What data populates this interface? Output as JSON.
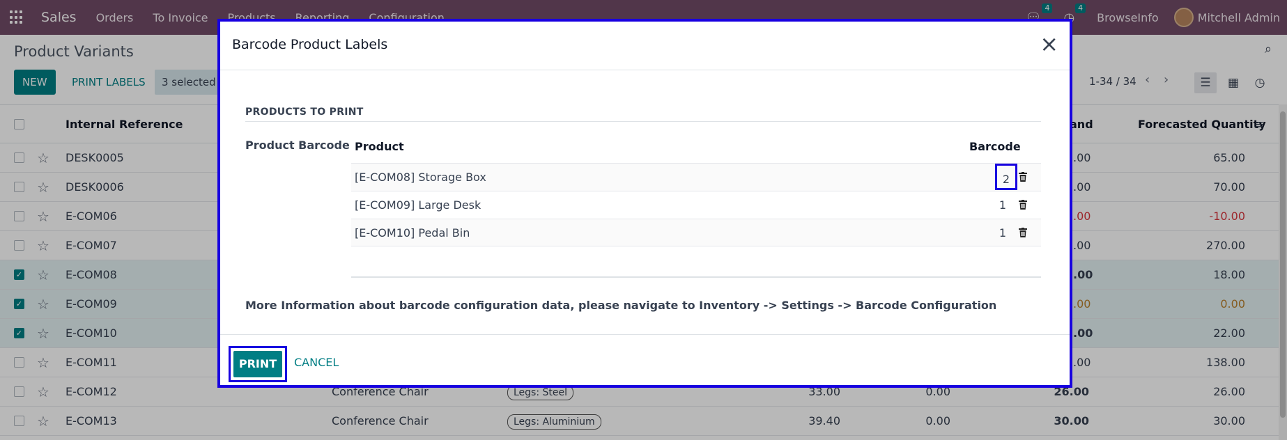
{
  "navbar": {
    "brand": "Sales",
    "menus": [
      "Orders",
      "To Invoice",
      "Products",
      "Reporting",
      "Configuration"
    ],
    "chat_count": "4",
    "activity_count": "4",
    "company": "BrowseInfo",
    "user": "Mitchell Admin"
  },
  "control": {
    "title": "Product Variants",
    "new_label": "NEW",
    "print_labels_label": "PRINT LABELS",
    "selected": "3 selected",
    "pager": "1-34 / 34"
  },
  "list": {
    "headers": {
      "internal_reference": "Internal Reference",
      "on_hand": "and",
      "forecasted": "Forecasted Quantity"
    },
    "rows": [
      {
        "ref": "DESK0005",
        "name": "",
        "attr": "",
        "price": "",
        "cost": "",
        "onhand": ".00",
        "forecast": "65.00",
        "selected": false
      },
      {
        "ref": "DESK0006",
        "name": "",
        "attr": "",
        "price": "",
        "cost": "",
        "onhand": ".00",
        "forecast": "70.00",
        "selected": false
      },
      {
        "ref": "E-COM06",
        "name": "",
        "attr": "",
        "price": "",
        "cost": "",
        "onhand": ".00",
        "forecast": "-10.00",
        "selected": false
      },
      {
        "ref": "E-COM07",
        "name": "",
        "attr": "",
        "price": "",
        "cost": "",
        "onhand": ".00",
        "forecast": "270.00",
        "selected": false
      },
      {
        "ref": "E-COM08",
        "name": "",
        "attr": "",
        "price": "",
        "cost": "",
        "onhand": ".00",
        "forecast": "18.00",
        "selected": true
      },
      {
        "ref": "E-COM09",
        "name": "",
        "attr": "",
        "price": "",
        "cost": "",
        "onhand": ".00",
        "forecast": "0.00",
        "selected": true
      },
      {
        "ref": "E-COM10",
        "name": "",
        "attr": "",
        "price": "",
        "cost": "",
        "onhand": ".00",
        "forecast": "22.00",
        "selected": true
      },
      {
        "ref": "E-COM11",
        "name": "",
        "attr": "",
        "price": "",
        "cost": "",
        "onhand": ".00",
        "forecast": "138.00",
        "selected": false
      },
      {
        "ref": "E-COM12",
        "name": "Conference Chair",
        "attr": "Legs: Steel",
        "price": "33.00",
        "cost": "0.00",
        "onhand": "26.00",
        "forecast": "26.00",
        "selected": false
      },
      {
        "ref": "E-COM13",
        "name": "Conference Chair",
        "attr": "Legs: Aluminium",
        "price": "39.40",
        "cost": "0.00",
        "onhand": "30.00",
        "forecast": "30.00",
        "selected": false
      }
    ]
  },
  "dialog": {
    "title": "Barcode Product Labels",
    "section": "PRODUCTS TO PRINT",
    "field_label": "Product Barcode",
    "col_product": "Product",
    "col_barcode": "Barcode",
    "lines": [
      {
        "product": "[E-COM08] Storage Box",
        "qty": "2"
      },
      {
        "product": "[E-COM09] Large Desk",
        "qty": "1"
      },
      {
        "product": "[E-COM10] Pedal Bin",
        "qty": "1"
      }
    ],
    "info": "More Information about barcode configuration data, please navigate to Inventory -> Settings -> Barcode Configuration",
    "print_label": "PRINT",
    "cancel_label": "CANCEL"
  },
  "colors": {
    "navbar": "#714b67",
    "primary": "#017e84",
    "highlight": "#1800e0",
    "negative": "#d9363e",
    "warning": "#b9802d"
  }
}
